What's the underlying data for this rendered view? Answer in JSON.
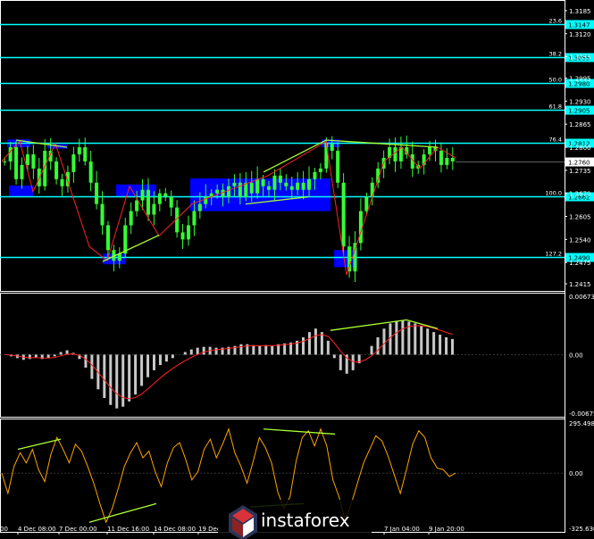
{
  "chart_data": [
    {
      "type": "line",
      "panel": "price",
      "yaxis_ticks": [
        "1.3185",
        "1.3120",
        "1.3055",
        "1.2995",
        "1.2930",
        "1.2865",
        "1.2800",
        "1.2735",
        "1.2670",
        "1.2605",
        "1.2540",
        "1.2475",
        "1.2415"
      ],
      "ylim": [
        1.2405,
        1.3205
      ],
      "fib_levels": [
        {
          "ratio": "23.6",
          "price": "1.3147",
          "value": 1.3147
        },
        {
          "ratio": "38.2",
          "price": "1.3055",
          "value": 1.3055
        },
        {
          "ratio": "50.0",
          "price": "1.2980",
          "value": 1.298
        },
        {
          "ratio": "61.8",
          "price": "1.2905",
          "value": 1.2905
        },
        {
          "ratio": "76.4",
          "price": "1.2812",
          "value": 1.2812
        },
        {
          "ratio": "100.0",
          "price": "1.2662",
          "value": 1.2662
        },
        {
          "ratio": "127.2",
          "price": "1.2490",
          "value": 1.249
        }
      ],
      "current_price": {
        "label": "1.2760",
        "value": 1.276
      },
      "close_series": [
        1.276,
        1.28,
        1.271,
        1.275,
        1.278,
        1.274,
        1.269,
        1.279,
        1.276,
        1.271,
        1.269,
        1.273,
        1.278,
        1.28,
        1.276,
        1.27,
        1.264,
        1.258,
        1.251,
        1.248,
        1.25,
        1.258,
        1.262,
        1.265,
        1.268,
        1.261,
        1.264,
        1.267,
        1.266,
        1.263,
        1.256,
        1.254,
        1.258,
        1.262,
        1.264,
        1.266,
        1.267,
        1.268,
        1.266,
        1.269,
        1.27,
        1.266,
        1.27,
        1.267,
        1.271,
        1.269,
        1.268,
        1.272,
        1.27,
        1.269,
        1.268,
        1.27,
        1.268,
        1.271,
        1.273,
        1.274,
        1.281,
        1.279,
        1.27,
        1.252,
        1.245,
        1.253,
        1.262,
        1.266,
        1.27,
        1.274,
        1.277,
        1.28,
        1.276,
        1.28,
        1.278,
        1.274,
        1.275,
        1.278,
        1.28,
        1.279,
        1.275,
        1.277,
        1.276
      ]
    },
    {
      "type": "bar",
      "panel": "macd",
      "yaxis_ticks": [
        "0.00673",
        "0.00",
        "-0.00675"
      ],
      "ylim": [
        -0.00675,
        0.00673
      ],
      "values": [
        0.0,
        -0.0002,
        -0.0004,
        -0.0006,
        -0.0005,
        -0.0003,
        -0.0005,
        -0.0004,
        -0.0002,
        0.0003,
        0.0005,
        0.0002,
        -0.0005,
        -0.0015,
        -0.0028,
        -0.004,
        -0.005,
        -0.0058,
        -0.0062,
        -0.006,
        -0.0054,
        -0.0046,
        -0.0036,
        -0.0026,
        -0.0018,
        -0.0012,
        -0.0008,
        -0.0004,
        0.0,
        0.0003,
        0.0006,
        0.0008,
        0.0009,
        0.0009,
        0.0008,
        0.0008,
        0.0009,
        0.001,
        0.0012,
        0.0012,
        0.0011,
        0.001,
        0.0011,
        0.001,
        0.0012,
        0.0013,
        0.0014,
        0.0016,
        0.002,
        0.0026,
        0.003,
        0.0026,
        0.0016,
        -0.0004,
        -0.0018,
        -0.0022,
        -0.0018,
        -0.001,
        0.0,
        0.001,
        0.002,
        0.003,
        0.0036,
        0.0039,
        0.004,
        0.0038,
        0.0036,
        0.0033,
        0.003,
        0.0026,
        0.0023,
        0.002,
        0.0018
      ]
    },
    {
      "type": "line",
      "panel": "cci",
      "yaxis_ticks": [
        "295.4989",
        "0.00",
        "-325.630"
      ],
      "ylim": [
        -325.63,
        295.4989
      ],
      "values": [
        0,
        -120,
        40,
        120,
        60,
        140,
        20,
        -50,
        110,
        210,
        140,
        60,
        170,
        130,
        40,
        -60,
        -180,
        -290,
        -210,
        -90,
        40,
        120,
        180,
        90,
        130,
        10,
        -80,
        60,
        150,
        180,
        80,
        -40,
        10,
        140,
        200,
        90,
        170,
        260,
        120,
        40,
        -60,
        70,
        210,
        150,
        60,
        -110,
        -210,
        -140,
        70,
        210,
        250,
        160,
        260,
        160,
        -40,
        -140,
        -280,
        -180,
        -60,
        60,
        140,
        220,
        190,
        100,
        -10,
        -120,
        20,
        170,
        250,
        210,
        90,
        30,
        20,
        -20,
        0
      ]
    }
  ],
  "xaxis_ticks": [
    "4 Dec 08:00",
    "7 Dec 00:00",
    "11 Dec 16:00",
    "14 Dec 08:00",
    "19 Dec",
    "7 Jan 04:00",
    "9 Jan 20:00"
  ],
  "xaxis_prefix": "00",
  "logo": "instaforex",
  "colors": {
    "background": "#000000",
    "fib": "#00ffff",
    "candles": "#33ff33",
    "zigzag": "#ff2222",
    "trendline": "#aaff33",
    "box": "#0000ff",
    "macd_hist": "#c8c8c8",
    "macd_signal": "#ff2222",
    "cci": "#ffa500"
  }
}
